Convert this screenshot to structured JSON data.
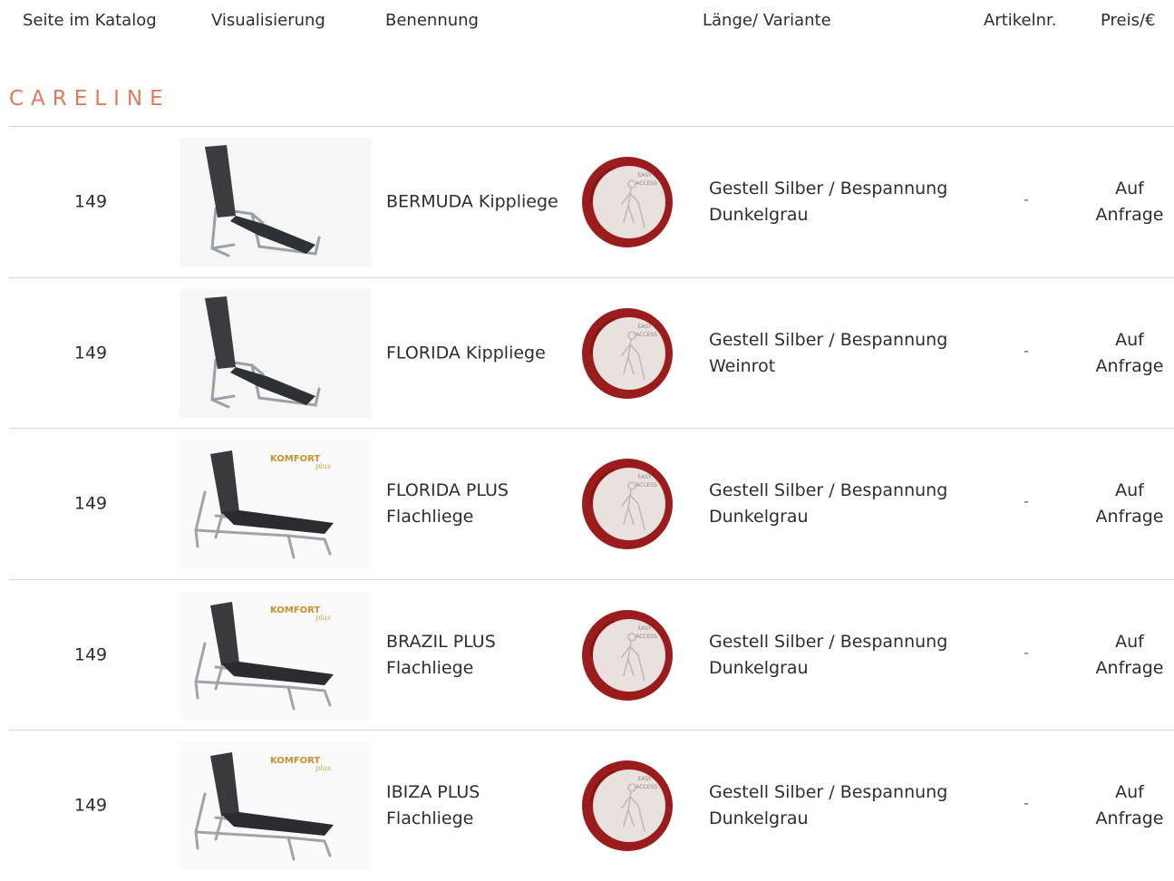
{
  "header": {
    "col_page": "Seite im Katalog",
    "col_visual": "Visualisierung",
    "col_name": "Benennung",
    "col_variant": "Länge/ Variante",
    "col_artnr": "Artikelnr.",
    "col_price": "Preis/€"
  },
  "section": {
    "title": "CARELINE"
  },
  "badge": {
    "line1": "EASY",
    "line2": "ACCESS",
    "icon": "wheelchair-walker-icon"
  },
  "products": [
    {
      "page": "149",
      "name": "BERMUDA Kippliege",
      "variant": "Gestell Silber / Bespannung Dunkelgrau",
      "artnr": "-",
      "price": "Auf Anfrage",
      "image": "chaise-recliner",
      "komfort_label": ""
    },
    {
      "page": "149",
      "name": "FLORIDA Kippliege",
      "variant": "Gestell Silber / Bespannung Weinrot",
      "artnr": "-",
      "price": "Auf Anfrage",
      "image": "chaise-recliner",
      "komfort_label": ""
    },
    {
      "page": "149",
      "name": "FLORIDA PLUS Flachliege",
      "variant": "Gestell Silber / Bespannung Dunkelgrau",
      "artnr": "-",
      "price": "Auf Anfrage",
      "image": "flat-lounger",
      "komfort_label": "KOMFORT"
    },
    {
      "page": "149",
      "name": "BRAZIL PLUS Flachliege",
      "variant": "Gestell Silber / Bespannung Dunkelgrau",
      "artnr": "-",
      "price": "Auf Anfrage",
      "image": "flat-lounger",
      "komfort_label": "KOMFORT"
    },
    {
      "page": "149",
      "name": "IBIZA PLUS Flachliege",
      "variant": "Gestell Silber / Bespannung Dunkelgrau",
      "artnr": "-",
      "price": "Auf Anfrage",
      "image": "flat-lounger",
      "komfort_label": "KOMFORT"
    }
  ],
  "colors": {
    "accent": "#e07a5c",
    "badge_ring": "#9b1c1c",
    "badge_fill": "#e9e1dd",
    "divider": "#d6d6d6",
    "text": "#2e2e2e"
  }
}
